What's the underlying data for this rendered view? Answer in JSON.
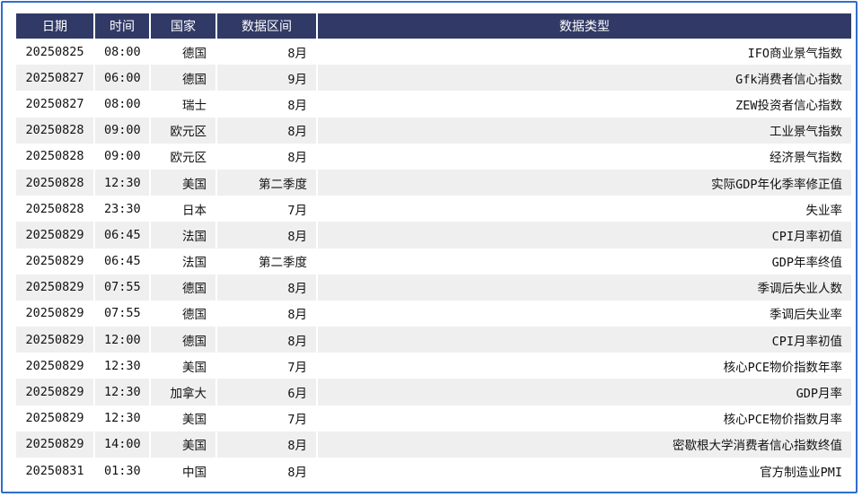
{
  "table": {
    "headers": [
      "日期",
      "时间",
      "国家",
      "数据区间",
      "数据类型"
    ],
    "rows": [
      [
        "20250825",
        "08:00",
        "德国",
        "8月",
        "IFO商业景气指数"
      ],
      [
        "20250827",
        "06:00",
        "德国",
        "9月",
        "Gfk消费者信心指数"
      ],
      [
        "20250827",
        "08:00",
        "瑞士",
        "8月",
        "ZEW投资者信心指数"
      ],
      [
        "20250828",
        "09:00",
        "欧元区",
        "8月",
        "工业景气指数"
      ],
      [
        "20250828",
        "09:00",
        "欧元区",
        "8月",
        "经济景气指数"
      ],
      [
        "20250828",
        "12:30",
        "美国",
        "第二季度",
        "实际GDP年化季率修正值"
      ],
      [
        "20250828",
        "23:30",
        "日本",
        "7月",
        "失业率"
      ],
      [
        "20250829",
        "06:45",
        "法国",
        "8月",
        "CPI月率初值"
      ],
      [
        "20250829",
        "06:45",
        "法国",
        "第二季度",
        "GDP年率终值"
      ],
      [
        "20250829",
        "07:55",
        "德国",
        "8月",
        "季调后失业人数"
      ],
      [
        "20250829",
        "07:55",
        "德国",
        "8月",
        "季调后失业率"
      ],
      [
        "20250829",
        "12:00",
        "德国",
        "8月",
        "CPI月率初值"
      ],
      [
        "20250829",
        "12:30",
        "美国",
        "7月",
        "核心PCE物价指数年率"
      ],
      [
        "20250829",
        "12:30",
        "加拿大",
        "6月",
        "GDP月率"
      ],
      [
        "20250829",
        "12:30",
        "美国",
        "7月",
        "核心PCE物价指数月率"
      ],
      [
        "20250829",
        "14:00",
        "美国",
        "8月",
        "密歇根大学消费者信心指数终值"
      ],
      [
        "20250831",
        "01:30",
        "中国",
        "8月",
        "官方制造业PMI"
      ]
    ]
  },
  "colors": {
    "header_bg": "#313a66",
    "header_text": "#ffffff",
    "stripe": "#efefef",
    "frame_border": "#2f6ecb"
  }
}
